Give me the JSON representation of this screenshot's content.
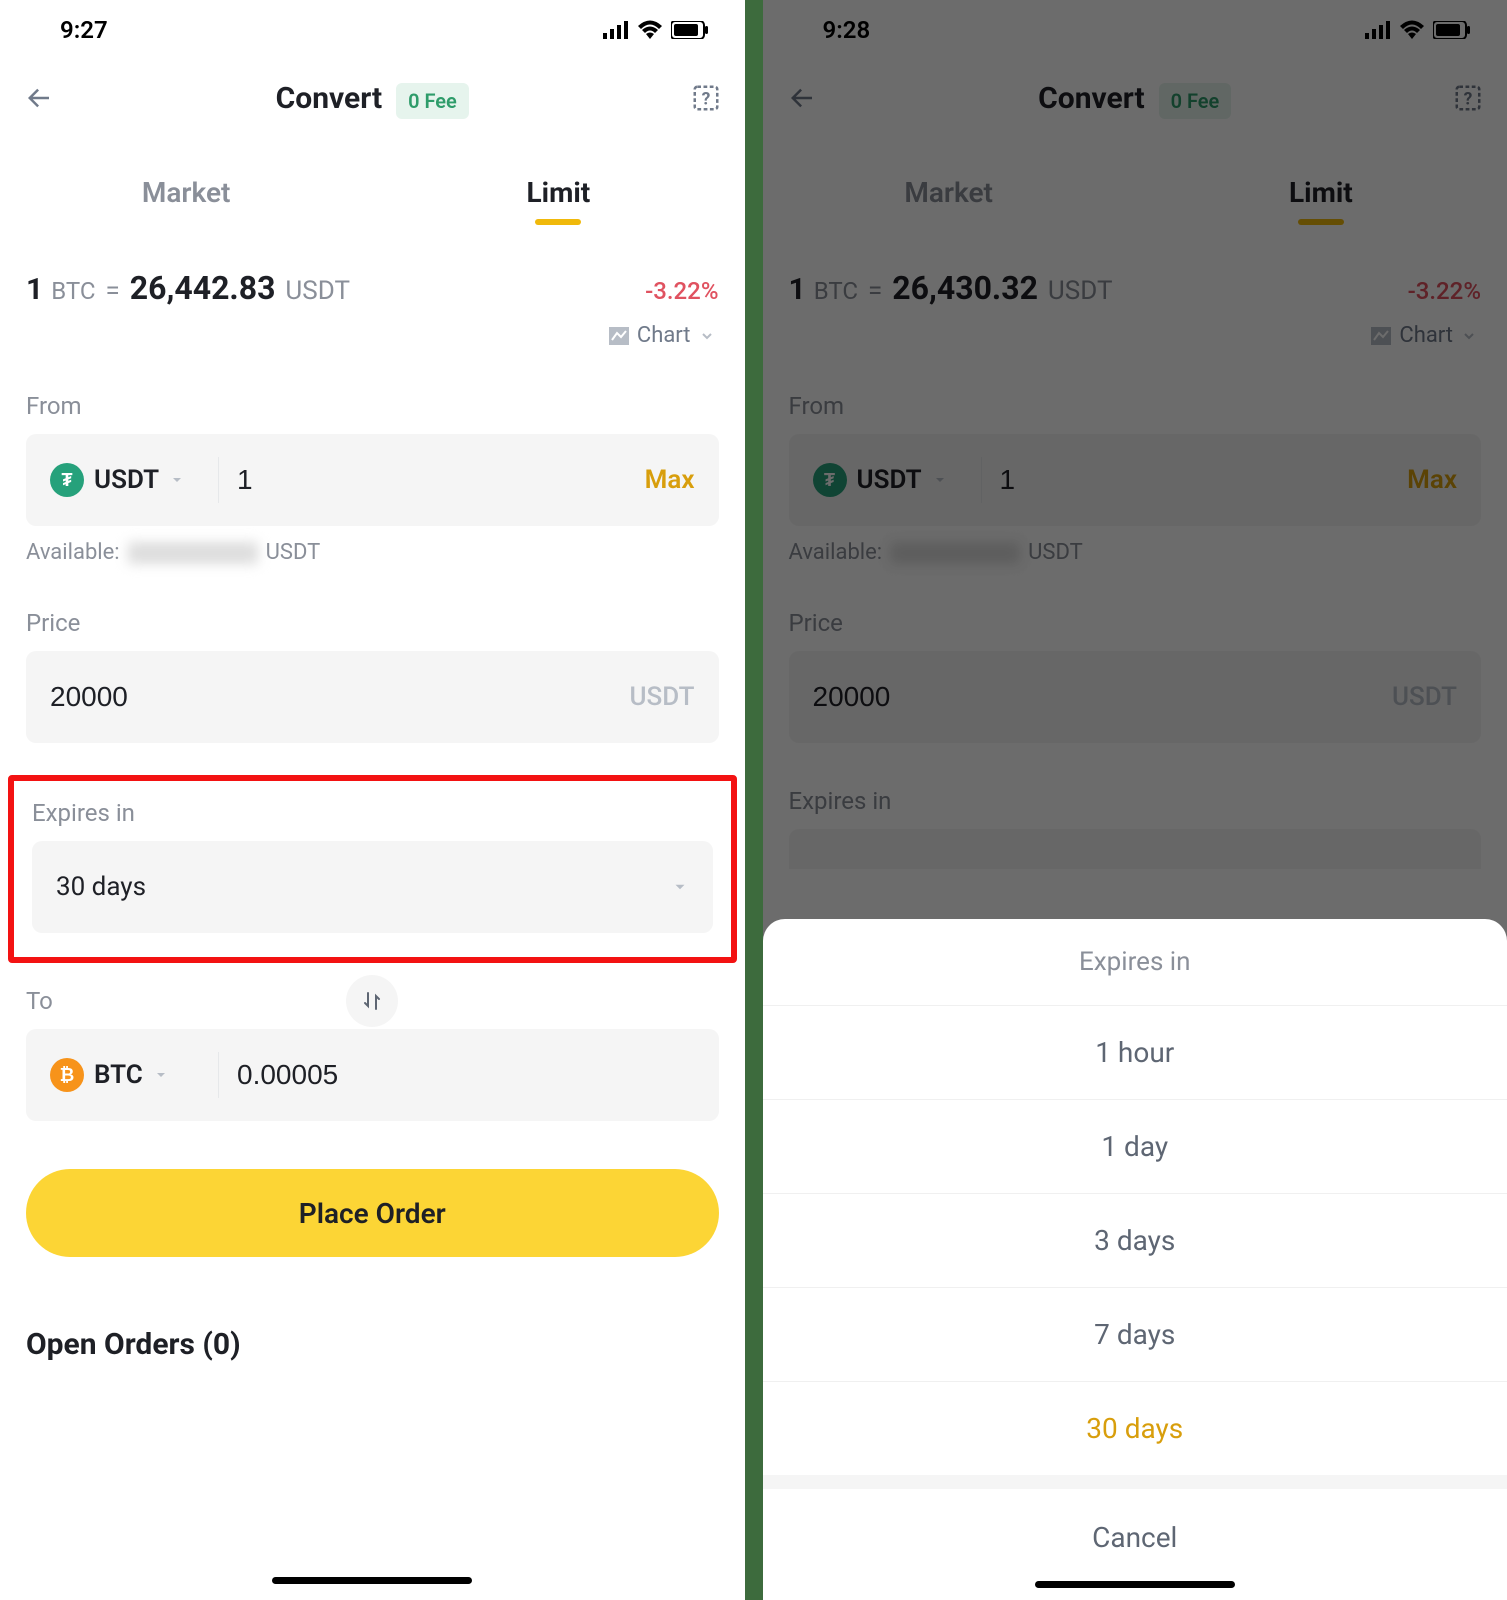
{
  "left": {
    "time": "9:27",
    "header": {
      "title": "Convert",
      "fee_badge": "0 Fee"
    },
    "tabs": {
      "market": "Market",
      "limit": "Limit"
    },
    "price": {
      "one": "1",
      "btc": "BTC",
      "eq": "=",
      "value": "26,442.83",
      "usdt": "USDT",
      "change": "-3.22%"
    },
    "chart_label": "Chart",
    "from_label": "From",
    "from_coin": "USDT",
    "from_value": "1",
    "max": "Max",
    "available_label": "Available:",
    "available_unit": "USDT",
    "price_label": "Price",
    "price_value": "20000",
    "price_unit": "USDT",
    "expires_label": "Expires in",
    "expires_value": "30 days",
    "to_label": "To",
    "to_coin": "BTC",
    "to_value": "0.00005",
    "place_order": "Place Order",
    "open_orders": "Open Orders (0)"
  },
  "right": {
    "time": "9:28",
    "header": {
      "title": "Convert",
      "fee_badge": "0 Fee"
    },
    "tabs": {
      "market": "Market",
      "limit": "Limit"
    },
    "price": {
      "one": "1",
      "btc": "BTC",
      "eq": "=",
      "value": "26,430.32",
      "usdt": "USDT",
      "change": "-3.22%"
    },
    "chart_label": "Chart",
    "from_label": "From",
    "from_coin": "USDT",
    "from_value": "1",
    "max": "Max",
    "available_label": "Available:",
    "available_unit": "USDT",
    "price_label": "Price",
    "price_value": "20000",
    "price_unit": "USDT",
    "expires_label": "Expires in",
    "sheet": {
      "title": "Expires in",
      "options": [
        "1 hour",
        "1 day",
        "3 days",
        "7 days",
        "30 days"
      ],
      "selected": "30 days",
      "cancel": "Cancel"
    }
  }
}
